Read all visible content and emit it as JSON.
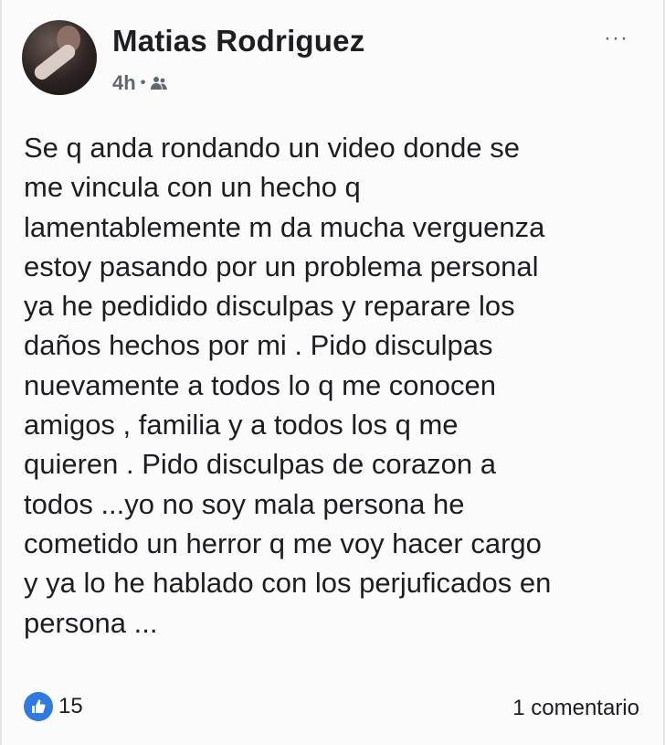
{
  "post": {
    "author": "Matias Rodriguez",
    "time": "4h",
    "separator": "•",
    "audience_icon": "friends-icon",
    "more_label": "···",
    "text": "Se q anda rondando un video donde se\nme vincula con un hecho q\nlamentablemente m da mucha verguenza\nestoy pasando por un problema personal\nya he pedidido disculpas y reparare los\ndaños hechos por mi . Pido disculpas\nnuevamente a todos lo q me conocen\namigos , familia y a todos los q me\nquieren . Pido disculpas de corazon a\ntodos ...yo no soy mala persona he\ncometido un herror q me voy hacer cargo\ny ya lo he hablado con los perjuficados en\npersona ...",
    "reactions": {
      "icon": "like-icon",
      "count": "15"
    },
    "comments_label": "1 comentario"
  },
  "colors": {
    "like": "#2f7ae0",
    "meta": "#606770",
    "text": "#1c1e21"
  }
}
